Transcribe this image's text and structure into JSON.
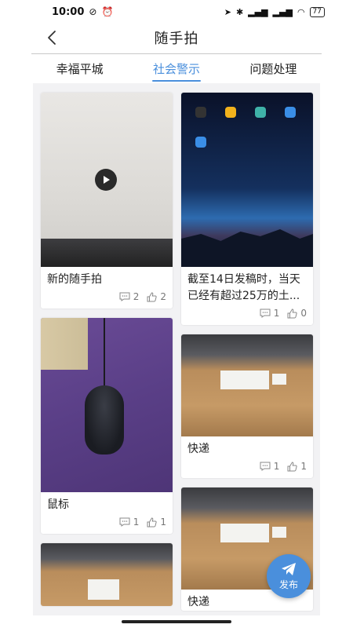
{
  "status_bar": {
    "time": "10:00",
    "battery": "77"
  },
  "header": {
    "title": "随手拍"
  },
  "tabs": [
    {
      "label": "幸福平城",
      "active": false
    },
    {
      "label": "社会警示",
      "active": true
    },
    {
      "label": "问题处理",
      "active": false
    }
  ],
  "posts": {
    "p1": {
      "title": "新的随手拍",
      "comments": "2",
      "likes": "2"
    },
    "p2": {
      "title": "截至14日发稿时，当天已经有超过25万的土...",
      "comments": "1",
      "likes": "0"
    },
    "p3": {
      "title": "鼠标",
      "comments": "1",
      "likes": "1"
    },
    "p4": {
      "title": "快递",
      "comments": "1",
      "likes": "1"
    },
    "p6": {
      "title": "快递"
    }
  },
  "fab": {
    "label": "发布"
  },
  "colors": {
    "accent": "#4a8fdc",
    "feed_bg": "#f2f2f4"
  },
  "icons": {
    "back": "chevron-left-icon",
    "comment": "comment-icon",
    "like": "thumbs-up-icon",
    "play": "play-icon",
    "send": "paper-plane-icon"
  }
}
